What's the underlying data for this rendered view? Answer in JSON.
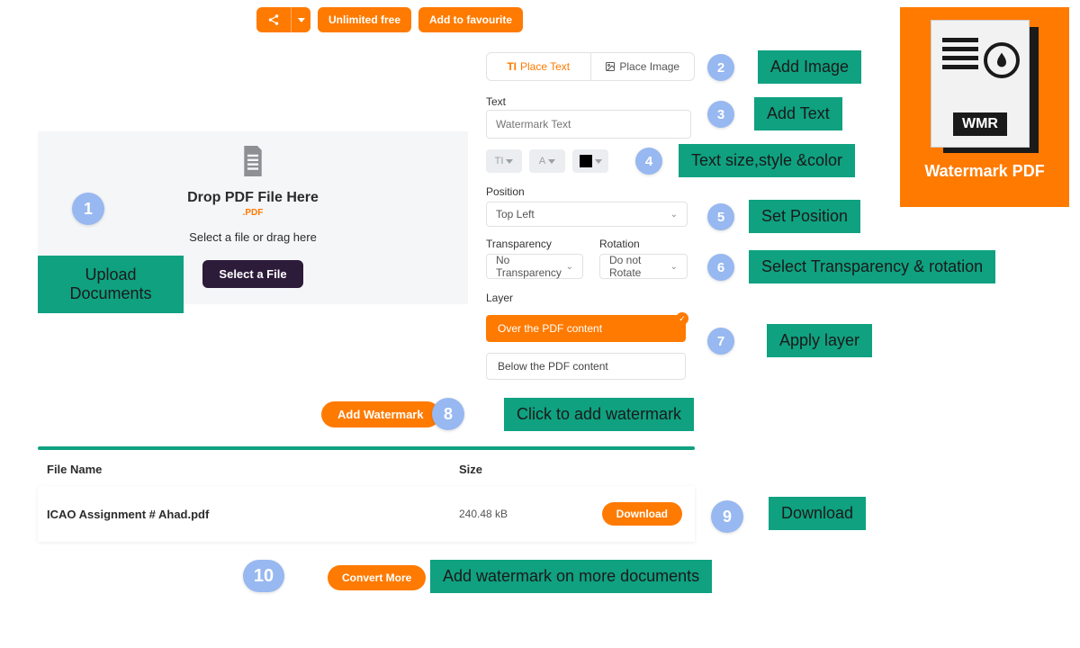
{
  "topbar": {
    "unlimited_label": "Unlimited free",
    "favourite_label": "Add to favourite"
  },
  "dropzone": {
    "title": "Drop PDF File Here",
    "ext": ".PDF",
    "subtitle": "Select a file or drag here",
    "select_btn": "Select a File"
  },
  "tabs": {
    "place_text": "Place Text",
    "place_image": "Place Image",
    "text_icon": "TI"
  },
  "text": {
    "label": "Text",
    "placeholder": "Watermark Text",
    "size_btn": "TI",
    "style_btn": "A"
  },
  "position": {
    "label": "Position",
    "value": "Top Left"
  },
  "transparency": {
    "label": "Transparency",
    "value": "No Transparency"
  },
  "rotation": {
    "label": "Rotation",
    "value": "Do not Rotate"
  },
  "layer": {
    "label": "Layer",
    "over": "Over the PDF content",
    "below": "Below the PDF content"
  },
  "actions": {
    "add_watermark": "Add Watermark",
    "convert_more": "Convert More",
    "download": "Download"
  },
  "table": {
    "col_file": "File Name",
    "col_size": "Size",
    "rows": [
      {
        "file": "ICAO Assignment # Ahad.pdf",
        "size": "240.48 kB"
      }
    ]
  },
  "annotations": {
    "n1": "1",
    "a1": "Upload Documents",
    "n2": "2",
    "a2": "Add Image",
    "n3": "3",
    "a3": "Add Text",
    "n4": "4",
    "a4": "Text size,style &color",
    "n5": "5",
    "a5": "Set Position",
    "n6": "6",
    "a6": "Select Transparency & rotation",
    "n7": "7",
    "a7": "Apply layer",
    "n8": "8",
    "a8": "Click to add watermark",
    "n9": "9",
    "a9": "Download",
    "n10": "10",
    "a10": "Add watermark on more documents"
  },
  "brand": {
    "wmr": "WMR",
    "title": "Watermark PDF"
  }
}
